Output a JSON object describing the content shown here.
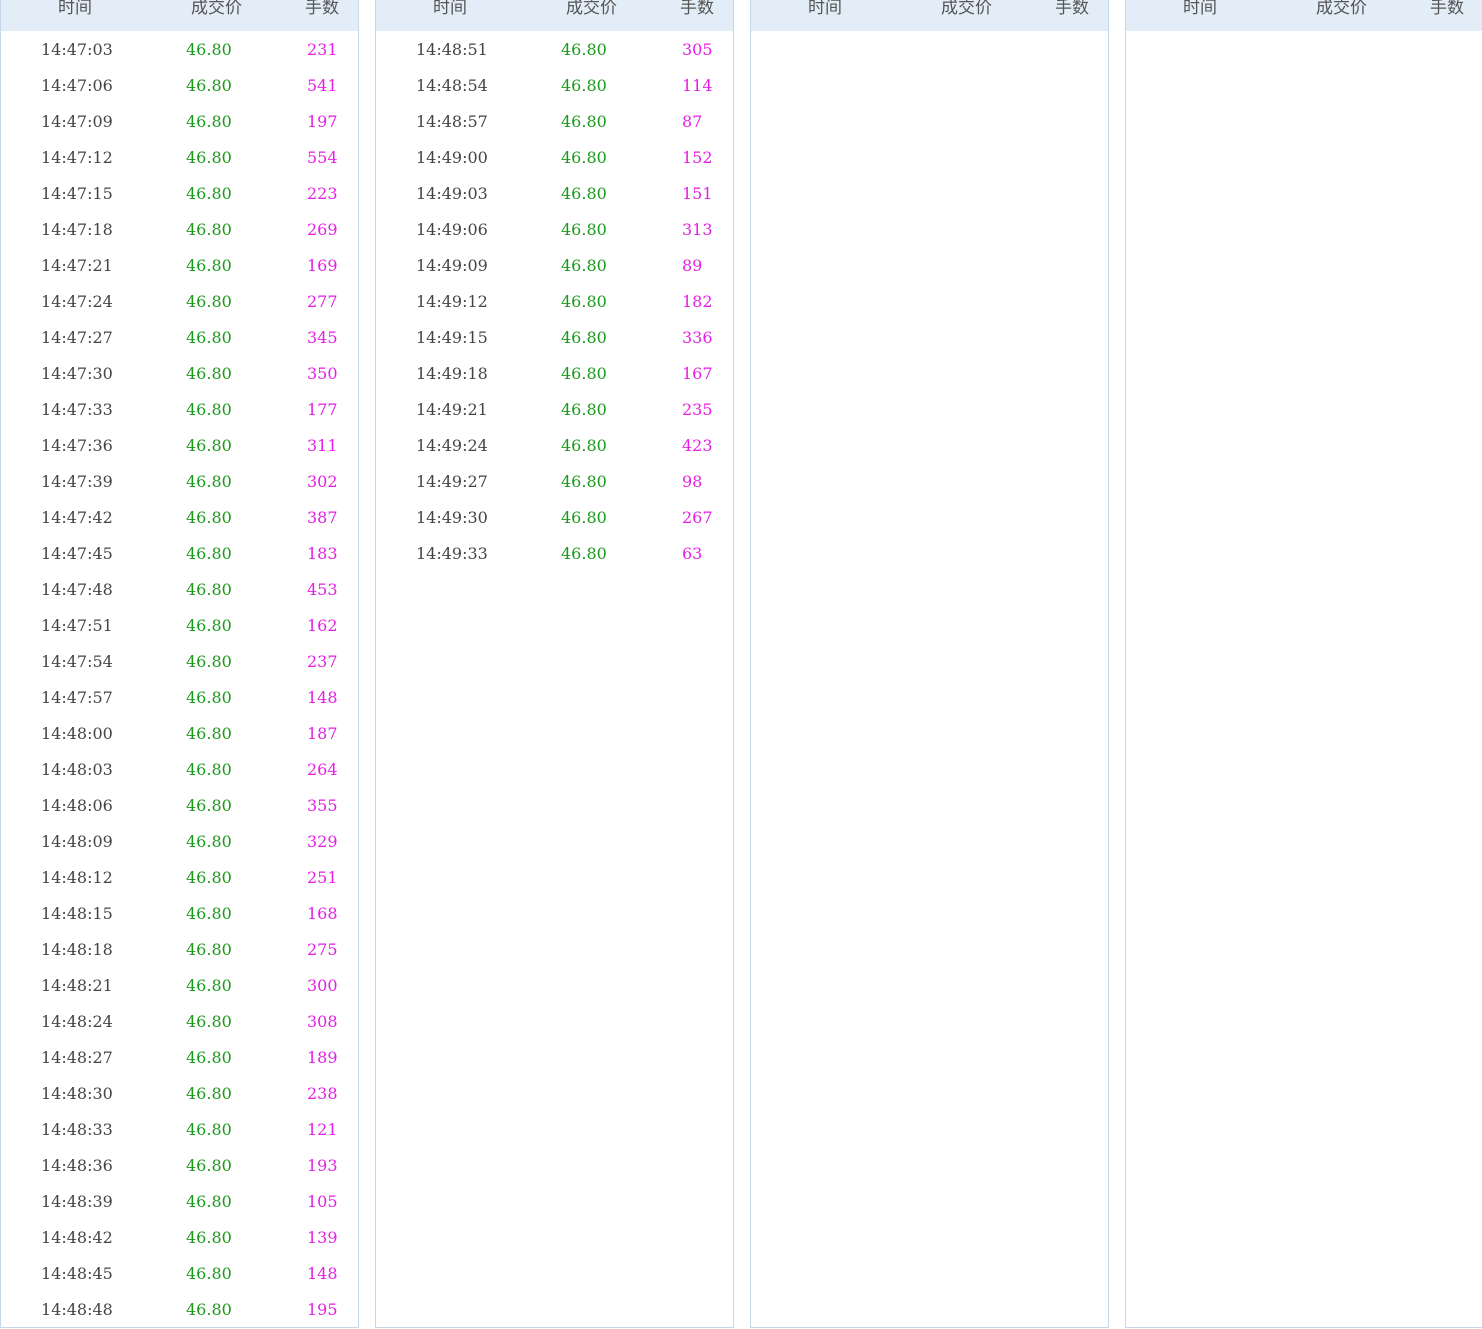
{
  "headers": {
    "time": "时间",
    "price": "成交价",
    "volume": "手数"
  },
  "colors": {
    "header_bg": "#e2edf8",
    "price": "#1a9a1a",
    "volume": "#e61ee6",
    "time": "#444444",
    "border": "#c5d7ea"
  },
  "panels": [
    {
      "rows": [
        {
          "t": "14:47:03",
          "p": "46.80",
          "v": "231"
        },
        {
          "t": "14:47:06",
          "p": "46.80",
          "v": "541"
        },
        {
          "t": "14:47:09",
          "p": "46.80",
          "v": "197"
        },
        {
          "t": "14:47:12",
          "p": "46.80",
          "v": "554"
        },
        {
          "t": "14:47:15",
          "p": "46.80",
          "v": "223"
        },
        {
          "t": "14:47:18",
          "p": "46.80",
          "v": "269"
        },
        {
          "t": "14:47:21",
          "p": "46.80",
          "v": "169"
        },
        {
          "t": "14:47:24",
          "p": "46.80",
          "v": "277"
        },
        {
          "t": "14:47:27",
          "p": "46.80",
          "v": "345"
        },
        {
          "t": "14:47:30",
          "p": "46.80",
          "v": "350"
        },
        {
          "t": "14:47:33",
          "p": "46.80",
          "v": "177"
        },
        {
          "t": "14:47:36",
          "p": "46.80",
          "v": "311"
        },
        {
          "t": "14:47:39",
          "p": "46.80",
          "v": "302"
        },
        {
          "t": "14:47:42",
          "p": "46.80",
          "v": "387"
        },
        {
          "t": "14:47:45",
          "p": "46.80",
          "v": "183"
        },
        {
          "t": "14:47:48",
          "p": "46.80",
          "v": "453"
        },
        {
          "t": "14:47:51",
          "p": "46.80",
          "v": "162"
        },
        {
          "t": "14:47:54",
          "p": "46.80",
          "v": "237"
        },
        {
          "t": "14:47:57",
          "p": "46.80",
          "v": "148"
        },
        {
          "t": "14:48:00",
          "p": "46.80",
          "v": "187"
        },
        {
          "t": "14:48:03",
          "p": "46.80",
          "v": "264"
        },
        {
          "t": "14:48:06",
          "p": "46.80",
          "v": "355"
        },
        {
          "t": "14:48:09",
          "p": "46.80",
          "v": "329"
        },
        {
          "t": "14:48:12",
          "p": "46.80",
          "v": "251"
        },
        {
          "t": "14:48:15",
          "p": "46.80",
          "v": "168"
        },
        {
          "t": "14:48:18",
          "p": "46.80",
          "v": "275"
        },
        {
          "t": "14:48:21",
          "p": "46.80",
          "v": "300"
        },
        {
          "t": "14:48:24",
          "p": "46.80",
          "v": "308"
        },
        {
          "t": "14:48:27",
          "p": "46.80",
          "v": "189"
        },
        {
          "t": "14:48:30",
          "p": "46.80",
          "v": "238"
        },
        {
          "t": "14:48:33",
          "p": "46.80",
          "v": "121"
        },
        {
          "t": "14:48:36",
          "p": "46.80",
          "v": "193"
        },
        {
          "t": "14:48:39",
          "p": "46.80",
          "v": "105"
        },
        {
          "t": "14:48:42",
          "p": "46.80",
          "v": "139"
        },
        {
          "t": "14:48:45",
          "p": "46.80",
          "v": "148"
        },
        {
          "t": "14:48:48",
          "p": "46.80",
          "v": "195"
        }
      ]
    },
    {
      "rows": [
        {
          "t": "14:48:51",
          "p": "46.80",
          "v": "305"
        },
        {
          "t": "14:48:54",
          "p": "46.80",
          "v": "114"
        },
        {
          "t": "14:48:57",
          "p": "46.80",
          "v": "87"
        },
        {
          "t": "14:49:00",
          "p": "46.80",
          "v": "152"
        },
        {
          "t": "14:49:03",
          "p": "46.80",
          "v": "151"
        },
        {
          "t": "14:49:06",
          "p": "46.80",
          "v": "313"
        },
        {
          "t": "14:49:09",
          "p": "46.80",
          "v": "89"
        },
        {
          "t": "14:49:12",
          "p": "46.80",
          "v": "182"
        },
        {
          "t": "14:49:15",
          "p": "46.80",
          "v": "336"
        },
        {
          "t": "14:49:18",
          "p": "46.80",
          "v": "167"
        },
        {
          "t": "14:49:21",
          "p": "46.80",
          "v": "235"
        },
        {
          "t": "14:49:24",
          "p": "46.80",
          "v": "423"
        },
        {
          "t": "14:49:27",
          "p": "46.80",
          "v": "98"
        },
        {
          "t": "14:49:30",
          "p": "46.80",
          "v": "267"
        },
        {
          "t": "14:49:33",
          "p": "46.80",
          "v": "63"
        }
      ]
    },
    {
      "rows": []
    },
    {
      "rows": []
    }
  ]
}
